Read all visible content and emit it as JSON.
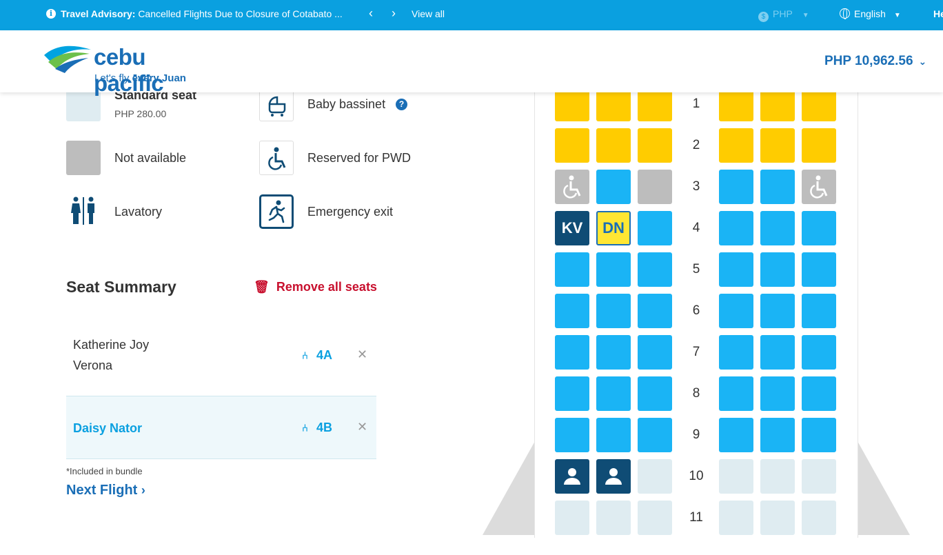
{
  "topbar": {
    "advisory_label": "Travel Advisory:",
    "advisory_text": "Cancelled Flights Due to Closure of Cotabato ...",
    "view_all": "View all",
    "currency": "PHP",
    "language": "English",
    "edge_text": "He"
  },
  "header": {
    "logo_wordmark": "cebu pacific",
    "logo_tagline_pre": "Let's fly ",
    "logo_tagline_bold": "every Juan",
    "total": "PHP 10,962.56"
  },
  "legend": {
    "standard_label": "Standard seat",
    "standard_price": "PHP 280.00",
    "bassinet_label": "Baby bassinet",
    "not_available_label": "Not available",
    "pwd_label": "Reserved for PWD",
    "lavatory_label": "Lavatory",
    "exit_label": "Emergency exit"
  },
  "summary": {
    "title": "Seat Summary",
    "remove_all": "Remove all seats",
    "passengers": [
      {
        "name_line1": "Katherine Joy",
        "name_line2": "Verona",
        "seat": "4A"
      },
      {
        "name_line1": "Daisy Nator",
        "name_line2": "",
        "seat": "4B"
      }
    ],
    "note": "*Included in bundle",
    "next_flight": "Next Flight"
  },
  "seatmap": {
    "rows": [
      "1",
      "2",
      "3",
      "4",
      "5",
      "6",
      "7",
      "8",
      "9",
      "10",
      "11"
    ],
    "seat_labels": {
      "kv": "KV",
      "dn": "DN"
    }
  },
  "colors": {
    "brand_blue": "#1a6eb6",
    "topbar_blue": "#0aa0e0",
    "premium_yellow": "#ffcc00",
    "standard_blue": "#1ab4f5",
    "remove_red": "#c8102e"
  }
}
